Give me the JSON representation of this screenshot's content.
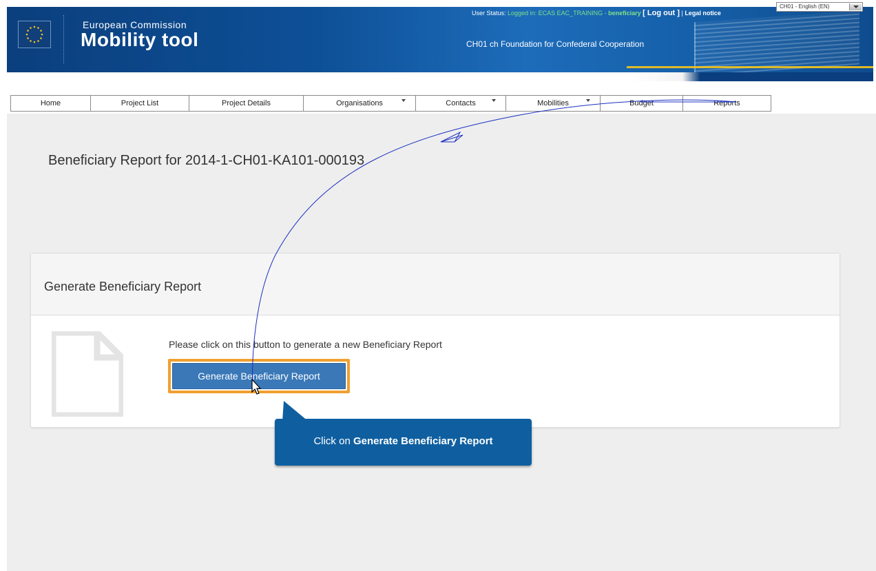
{
  "header": {
    "brand_small": "European Commission",
    "brand_big": "Mobility tool",
    "organisation": "CH01 ch Foundation for Confederal Cooperation",
    "status_label": "User Status:",
    "status_value": "Logged in: ECAS EAC_TRAINING -",
    "status_role": "beneficiary",
    "logout_label": "[ Log out ]",
    "legal_notice": "Legal notice",
    "language_selected": "CH01 - English (EN)"
  },
  "nav": {
    "items": [
      {
        "label": "Home"
      },
      {
        "label": "Project List"
      },
      {
        "label": "Project Details"
      },
      {
        "label": "Organisations"
      },
      {
        "label": "Contacts"
      },
      {
        "label": "Mobilities"
      },
      {
        "label": "Budget"
      },
      {
        "label": "Reports"
      }
    ]
  },
  "page": {
    "title": "Beneficiary Report for 2014-1-CH01-KA101-000193"
  },
  "panel": {
    "title": "Generate Beneficiary Report",
    "instruction": "Please click on this button to generate a new Beneficiary Report",
    "button_label": "Generate Beneficiary Report"
  },
  "callout": {
    "prefix": "Click on",
    "emphasis": "Generate Beneficiary Report"
  },
  "colors": {
    "header_blue": "#0d4f96",
    "button_blue": "#3a78b8",
    "highlight_orange": "#f0a030",
    "callout_blue": "#0f5fa0",
    "annotation_line": "#1a2fc0"
  },
  "icons": {
    "flag": "eu-flag-icon",
    "document": "document-icon",
    "cursor": "mouse-pointer-icon"
  }
}
